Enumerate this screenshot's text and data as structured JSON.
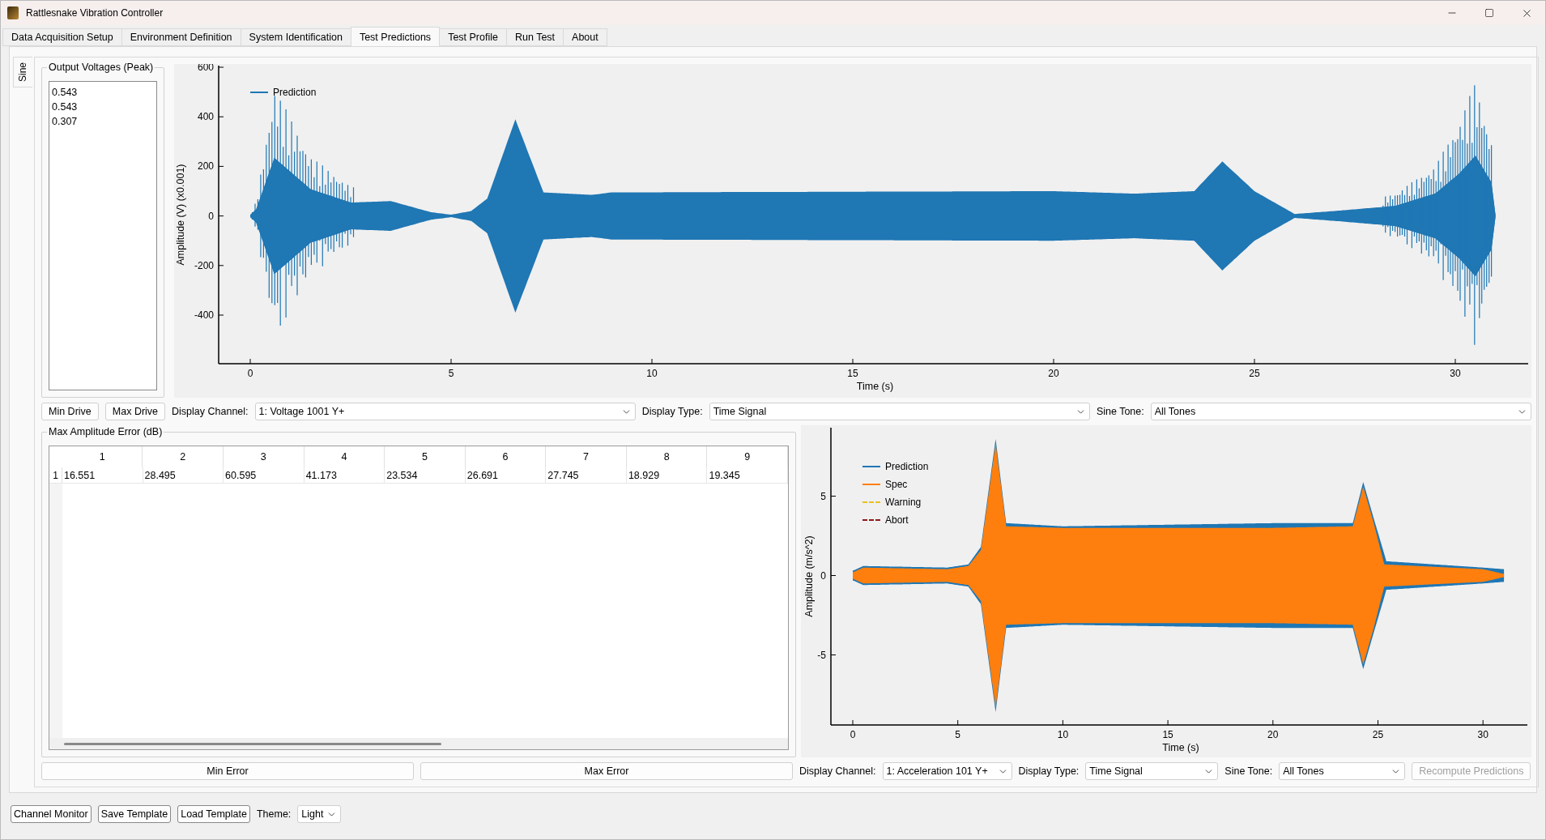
{
  "window": {
    "title": "Rattlesnake Vibration Controller"
  },
  "tabs": [
    {
      "label": "Data Acquisition Setup",
      "selected": false
    },
    {
      "label": "Environment Definition",
      "selected": false
    },
    {
      "label": "System Identification",
      "selected": false
    },
    {
      "label": "Test Predictions",
      "selected": true
    },
    {
      "label": "Test Profile",
      "selected": false
    },
    {
      "label": "Run Test",
      "selected": false
    },
    {
      "label": "About",
      "selected": false
    }
  ],
  "side_tabs": [
    {
      "label": "Sine",
      "selected": true
    }
  ],
  "output_voltages": {
    "title": "Output Voltages (Peak)",
    "items": [
      "0.543",
      "0.543",
      "0.307"
    ]
  },
  "top_plot": {
    "ylabel": "Amplitude (V) (x0.001)",
    "xlabel": "Time (s)",
    "yticks": [
      "600",
      "400",
      "200",
      "0",
      "-200",
      "-400"
    ],
    "xticks": [
      "0",
      "5",
      "10",
      "15",
      "20",
      "25",
      "30"
    ],
    "legend": [
      {
        "label": "Prediction",
        "color": "#1f77b4",
        "kind": "solid"
      }
    ]
  },
  "drive_controls": {
    "buttons": [
      "Min Drive",
      "Max Drive"
    ],
    "selects": [
      {
        "label": "Display Channel:",
        "value": "1: Voltage 1001 Y+"
      },
      {
        "label": "Display Type:",
        "value": "Time Signal"
      },
      {
        "label": "Sine Tone:",
        "value": "All Tones"
      }
    ]
  },
  "error_table": {
    "title": "Max Amplitude Error (dB)",
    "columns": [
      "1",
      "2",
      "3",
      "4",
      "5",
      "6",
      "7",
      "8",
      "9"
    ],
    "rows": [
      {
        "header": "1",
        "cells": [
          "16.551",
          "28.495",
          "60.595",
          "41.173",
          "23.534",
          "26.691",
          "27.745",
          "18.929",
          "19.345"
        ]
      }
    ]
  },
  "bottom_plot": {
    "ylabel": "Amplitude (m/s^2)",
    "xlabel": "Time (s)",
    "yticks": [
      "5",
      "0",
      "-5"
    ],
    "xticks": [
      "0",
      "5",
      "10",
      "15",
      "20",
      "25",
      "30"
    ],
    "legend": [
      {
        "label": "Prediction",
        "color": "#1f77b4",
        "kind": "solid"
      },
      {
        "label": "Spec",
        "color": "#ff7f0e",
        "kind": "solid"
      },
      {
        "label": "Warning",
        "color": "#e8c21a",
        "kind": "dashed"
      },
      {
        "label": "Abort",
        "color": "#8b1a1a",
        "kind": "dashed"
      }
    ]
  },
  "error_controls": {
    "buttons": [
      "Min Error",
      "Max Error"
    ],
    "selects": [
      {
        "label": "Display Channel:",
        "value": "1: Acceleration 101 Y+"
      },
      {
        "label": "Display Type:",
        "value": "Time Signal"
      },
      {
        "label": "Sine Tone:",
        "value": "All Tones"
      }
    ],
    "action": {
      "label": "Recompute Predictions",
      "disabled": true
    }
  },
  "footer": {
    "buttons": [
      "Channel Monitor",
      "Save Template",
      "Load Template"
    ],
    "theme": {
      "label": "Theme:",
      "value": "Light"
    }
  }
}
